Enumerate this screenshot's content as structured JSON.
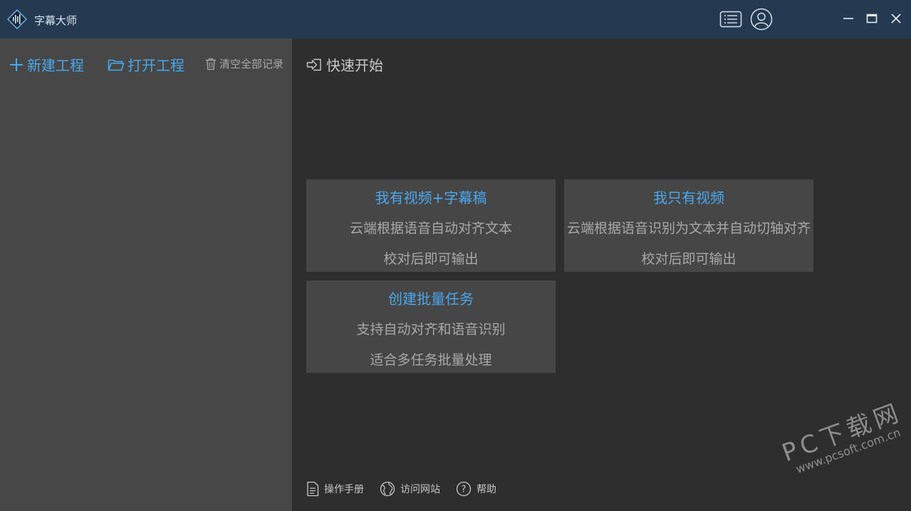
{
  "window": {
    "title": "字幕大师",
    "title_bar_color": "#253a50"
  },
  "sidebar": {
    "new_project": "新建工程",
    "open_project": "打开工程",
    "clear_records": "清空全部记录"
  },
  "main": {
    "quick_start": "快速开始",
    "cards": [
      {
        "title": "我有视频+字幕稿",
        "line1": "云端根据语音自动对齐文本",
        "line2": "校对后即可输出"
      },
      {
        "title": "我只有视频",
        "line1": "云端根据语音识别为文本并自动切轴对齐",
        "line2": "校对后即可输出"
      },
      {
        "title": "创建批量任务",
        "line1": "支持自动对齐和语音识别",
        "line2": "适合多任务批量处理"
      }
    ],
    "footer": {
      "manual": "操作手册",
      "visit_site": "访问网站",
      "help": "帮助"
    }
  },
  "watermark": {
    "title": "PC下载网",
    "url": "www.pcsoft.com.cn"
  },
  "colors": {
    "accent": "#4aa8ee",
    "sidebar_bg": "#474747",
    "main_bg": "#2e2e2e",
    "card_bg": "#464646"
  }
}
